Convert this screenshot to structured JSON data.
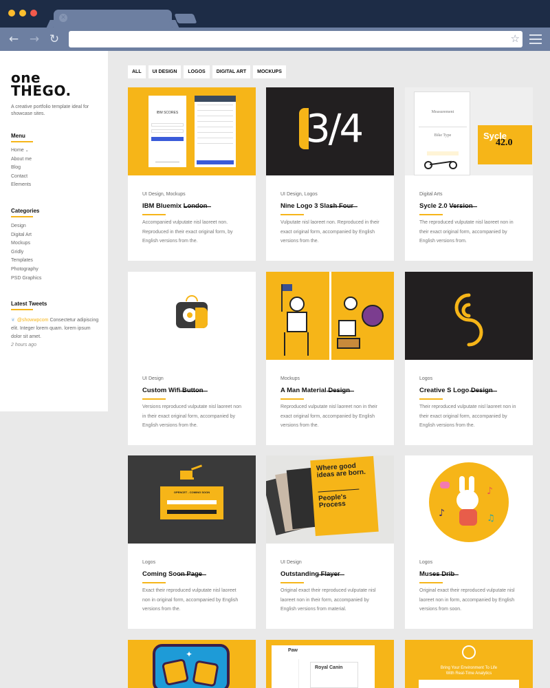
{
  "browser": {
    "address": "",
    "back_icon": "back-arrow-icon",
    "forward_icon": "forward-arrow-icon",
    "reload_icon": "reload-icon",
    "bookmark_icon": "star-icon",
    "menu_icon": "hamburger-menu-icon"
  },
  "sidebar": {
    "logo_line1": "onE",
    "logo_line2": "THEGO.",
    "tagline": "A creative portfolio template ideal for showcase sites.",
    "menu_heading": "Menu",
    "menu_items": [
      "Home",
      "About me",
      "Blog",
      "Contact",
      "Elements"
    ],
    "categories_heading": "Categories",
    "categories": [
      "Design",
      "Digital Art",
      "Mockups",
      "Gridly",
      "Templates",
      "Photography",
      "PSD Graphics"
    ],
    "tweets_heading": "Latest Tweets",
    "tweet_handle": "@showwpcom",
    "tweet_text": "Consectetur adipiscing elit. Integer lorem quam. lorem ipsum dolor sit amet.",
    "tweet_time": "2 hours ago"
  },
  "filters": [
    "ALL",
    "UI DESIGN",
    "LOGOS",
    "DIGITAL ART",
    "MOCKUPS"
  ],
  "cards": [
    {
      "category": "UI Design, Mockups",
      "title": "IBM Bluemix London",
      "description": "Accompanied vulputate nisl laoreet non. Reproduced in their exact original form, by English versions from the."
    },
    {
      "category": "UI Design, Logos",
      "title": "Nine Logo 3 Slash Four",
      "description": "Vulputate nisl laoreet non. Reproduced in their exact original form, accompanied by English versions from the."
    },
    {
      "category": "Digital Arts",
      "title": "Sycle 2.0 Version",
      "description": "The reproduced vulputate nisl laoreet non in their exact original form, accompanied by English versions from."
    },
    {
      "category": "UI Design",
      "title": "Custom Wifi Button",
      "description": "Versions reproduced vulputate nisl laoreet non in their exact original form, accompanied by English versions from the."
    },
    {
      "category": "Mockups",
      "title": "A Man Material Design",
      "description": "Reproduced vulputate nisl laoreet non in their exact original form, accompanied by English versions from the."
    },
    {
      "category": "Logos",
      "title": "Creative S Logo Design",
      "description": "Their reproduced vulputate nisl laoreet non in their exact original form, accompanied by English versions from the."
    },
    {
      "category": "Logos",
      "title": "Coming Soon Page",
      "description": "Exact their reproduced vulputate nisl laoreet non in original form, accompanied by English versions from the."
    },
    {
      "category": "UI Design",
      "title": "Outstanding Flayer",
      "description": "Original exact their reproduced vulputate nisl laoreet non in their form, accompanied by English versions from material."
    },
    {
      "category": "Logos",
      "title": "Muses Drib",
      "description": "Original exact their reproduced vulputate nisl laoreet non in form, accompanied by English versions from soon."
    }
  ],
  "thumb_text": {
    "ibm_scores": "IBM SCORES",
    "nine_logo": "3/4",
    "sycle": "Sycle",
    "sycle_version": "42.0",
    "measurement": "Measurement",
    "bike_type": "Bike Type",
    "coming_soon": "OPENCET - COMING SOON",
    "flyer_text1": "Where good ideas are born.",
    "flyer_text2": "People's Process",
    "paw": "Paw",
    "royal_canin": "Royal Canin",
    "analytics_line1": "Bring Your Environment To Life",
    "analytics_line2": "With Real-Time Analytics"
  },
  "colors": {
    "accent": "#f6b518",
    "chrome_dark": "#1d2c46",
    "chrome_toolbar": "#6d7fa1",
    "background": "#e9e9e9"
  }
}
